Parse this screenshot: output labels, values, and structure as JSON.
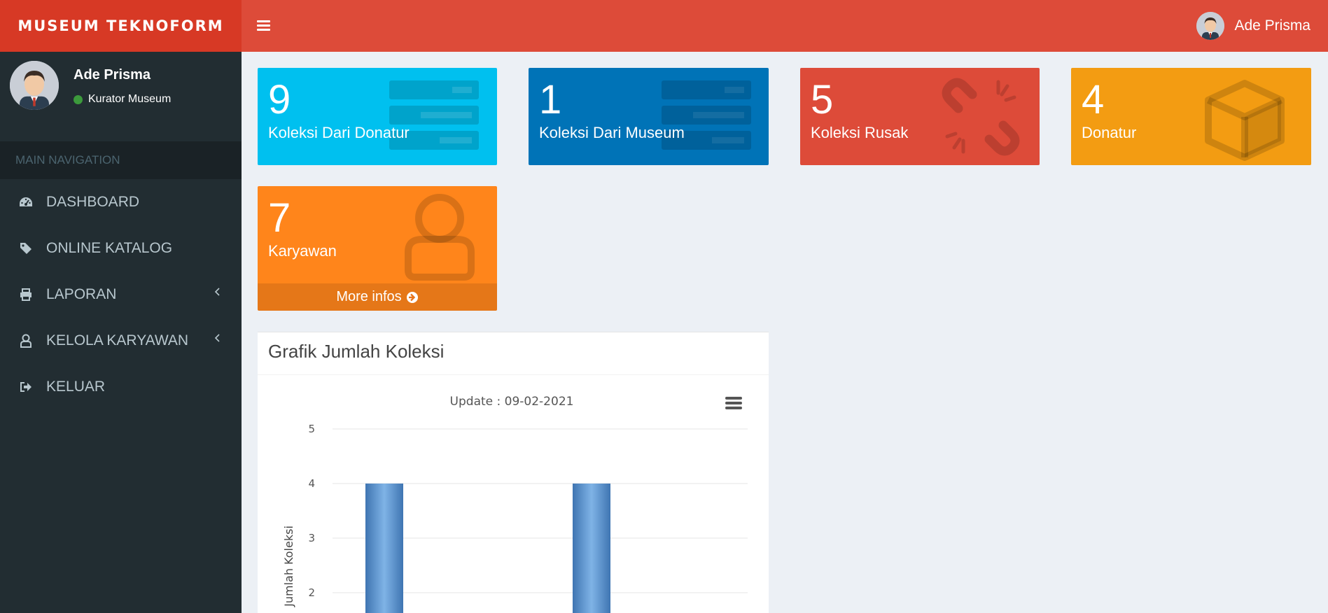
{
  "app": {
    "logo": "MUSEUM TEKNOFORM"
  },
  "header": {
    "user_name": "Ade Prisma"
  },
  "sidebar": {
    "user": {
      "name": "Ade Prisma",
      "role": "Kurator Museum",
      "status_color": "#3c9a3c"
    },
    "nav_header": "MAIN NAVIGATION",
    "items": [
      {
        "label": "DASHBOARD",
        "icon": "dashboard-icon"
      },
      {
        "label": "ONLINE KATALOG",
        "icon": "tag-icon"
      },
      {
        "label": "LAPORAN",
        "icon": "print-icon",
        "has_submenu": true
      },
      {
        "label": "KELOLA KARYAWAN",
        "icon": "user-icon",
        "has_submenu": true
      },
      {
        "label": "KELUAR",
        "icon": "sign-out-icon"
      }
    ]
  },
  "boxes": [
    {
      "value": "9",
      "label": "Koleksi Dari Donatur",
      "color": "#00c0ef",
      "icon": "server-icon"
    },
    {
      "value": "1",
      "label": "Koleksi Dari Museum",
      "color": "#0073b7",
      "icon": "server-icon"
    },
    {
      "value": "5",
      "label": "Koleksi Rusak",
      "color": "#dd4b39",
      "icon": "broken-link-icon"
    },
    {
      "value": "4",
      "label": "Donatur",
      "color": "#f39c12",
      "icon": "cube-icon"
    },
    {
      "value": "7",
      "label": "Karyawan",
      "color": "#ff851b",
      "icon": "user-icon",
      "more": "More infos"
    }
  ],
  "chart_card": {
    "title": "Grafik Jumlah Koleksi"
  },
  "chart_data": {
    "type": "bar",
    "title": "Update : 09-02-2021",
    "ylabel": "Jumlah Koleksi",
    "xlabel": "",
    "ylim": [
      0,
      5
    ],
    "y_ticks": [
      "5",
      "4",
      "3",
      "2"
    ],
    "series": [
      {
        "values": [
          4,
          4
        ]
      }
    ],
    "grid": true,
    "menu_icon": "hamburger-menu-icon"
  }
}
